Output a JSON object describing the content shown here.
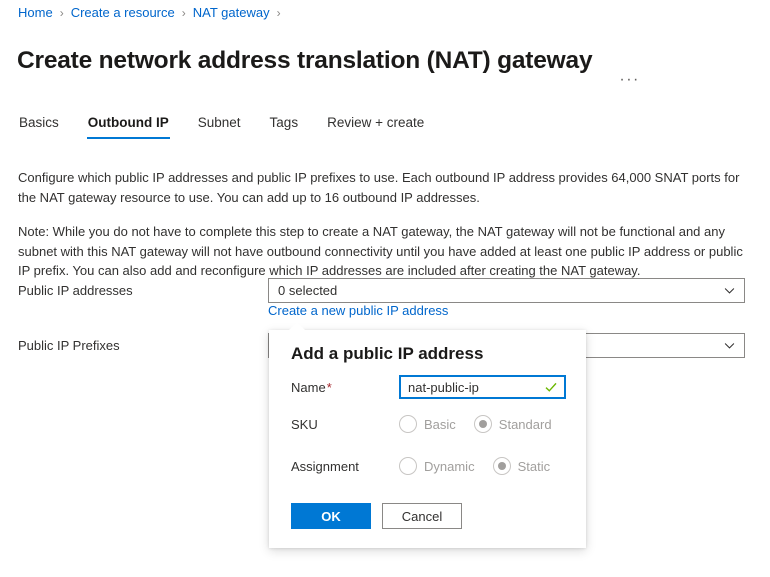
{
  "breadcrumb": {
    "separator": "›",
    "items": [
      {
        "label": "Home"
      },
      {
        "label": "Create a resource"
      },
      {
        "label": "NAT gateway"
      }
    ]
  },
  "header": {
    "title": "Create network address translation (NAT) gateway",
    "more_actions": "···"
  },
  "tabs": [
    {
      "label": "Basics",
      "active": false
    },
    {
      "label": "Outbound IP",
      "active": true
    },
    {
      "label": "Subnet",
      "active": false
    },
    {
      "label": "Tags",
      "active": false
    },
    {
      "label": "Review + create",
      "active": false
    }
  ],
  "main": {
    "description_1": "Configure which public IP addresses and public IP prefixes to use. Each outbound IP address provides 64,000 SNAT ports for the NAT gateway resource to use. You can add up to 16 outbound IP addresses.",
    "description_2": "Note: While you do not have to complete this step to create a NAT gateway, the NAT gateway will not be functional and any subnet with this NAT gateway will not have outbound connectivity until you have added at least one public IP address or public IP prefix. You can also add and reconfigure which IP addresses are included after creating the NAT gateway.",
    "public_ip_addresses": {
      "label": "Public IP addresses",
      "value": "0 selected",
      "create_link": "Create a new public IP address"
    },
    "public_ip_prefixes": {
      "label": "Public IP Prefixes",
      "value": ""
    }
  },
  "callout": {
    "title": "Add a public IP address",
    "name_field": {
      "label": "Name",
      "required_marker": "*",
      "value": "nat-public-ip"
    },
    "sku": {
      "label": "SKU",
      "options": [
        {
          "label": "Basic",
          "selected": false
        },
        {
          "label": "Standard",
          "selected": true
        }
      ]
    },
    "assignment": {
      "label": "Assignment",
      "options": [
        {
          "label": "Dynamic",
          "selected": false
        },
        {
          "label": "Static",
          "selected": true
        }
      ]
    },
    "ok_label": "OK",
    "cancel_label": "Cancel"
  },
  "colors": {
    "accent": "#0078d4",
    "link": "#0066cc",
    "required": "#a4262c",
    "valid_check": "#498205",
    "text": "#323130",
    "disabled_text": "#a19f9d"
  }
}
